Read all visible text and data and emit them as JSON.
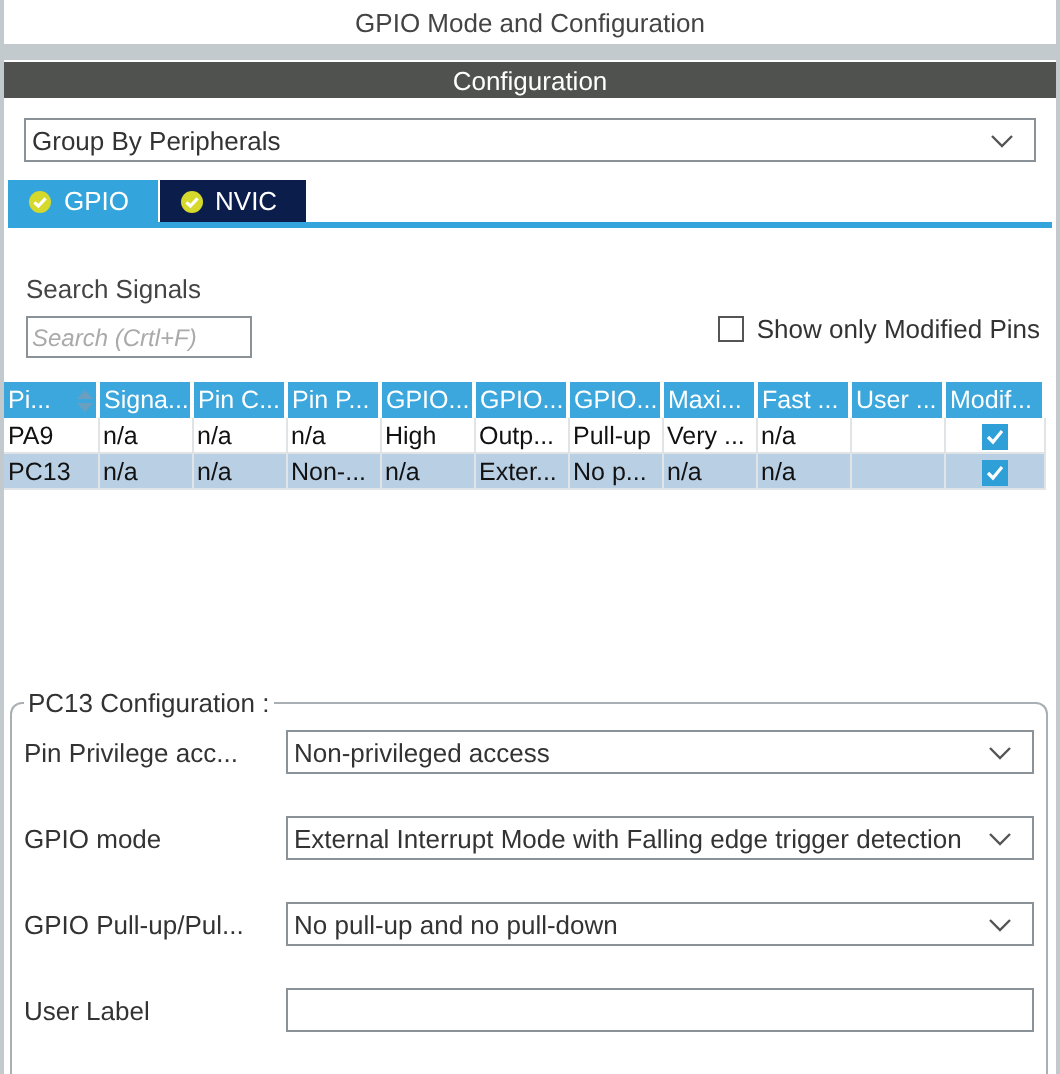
{
  "window": {
    "title": "GPIO Mode and Configuration"
  },
  "configuration": {
    "header": "Configuration",
    "group_by": "Group By Peripherals",
    "tabs": [
      {
        "label": "GPIO",
        "selected": true
      },
      {
        "label": "NVIC",
        "selected": false
      }
    ],
    "search": {
      "label": "Search Signals",
      "placeholder": "Search (Crtl+F)"
    },
    "show_modified": {
      "label": "Show only Modified Pins",
      "checked": false
    },
    "table": {
      "columns": [
        "Pi...",
        "Signa...",
        "Pin C...",
        "Pin P...",
        "GPIO...",
        "GPIO...",
        "GPIO...",
        "Maxi...",
        "Fast ...",
        "User ...",
        "Modif..."
      ],
      "rows": [
        {
          "cells": [
            "PA9",
            "n/a",
            "n/a",
            "n/a",
            "High",
            "Outp...",
            "Pull-up",
            "Very ...",
            "n/a"
          ],
          "modified": true,
          "selected": false
        },
        {
          "cells": [
            "PC13",
            "n/a",
            "n/a",
            "Non-...",
            "n/a",
            "Exter...",
            "No p...",
            "n/a",
            "n/a"
          ],
          "modified": true,
          "selected": true
        }
      ]
    },
    "pin_config": {
      "title": "PC13 Configuration :",
      "fields": [
        {
          "label": "Pin Privilege acc...",
          "kind": "select",
          "value": "Non-privileged access"
        },
        {
          "label": "GPIO mode",
          "kind": "select",
          "value": "External Interrupt Mode with Falling edge trigger detection"
        },
        {
          "label": "GPIO Pull-up/Pul...",
          "kind": "select",
          "value": "No pull-up and no pull-down"
        },
        {
          "label": "User Label",
          "kind": "text"
        }
      ]
    }
  }
}
